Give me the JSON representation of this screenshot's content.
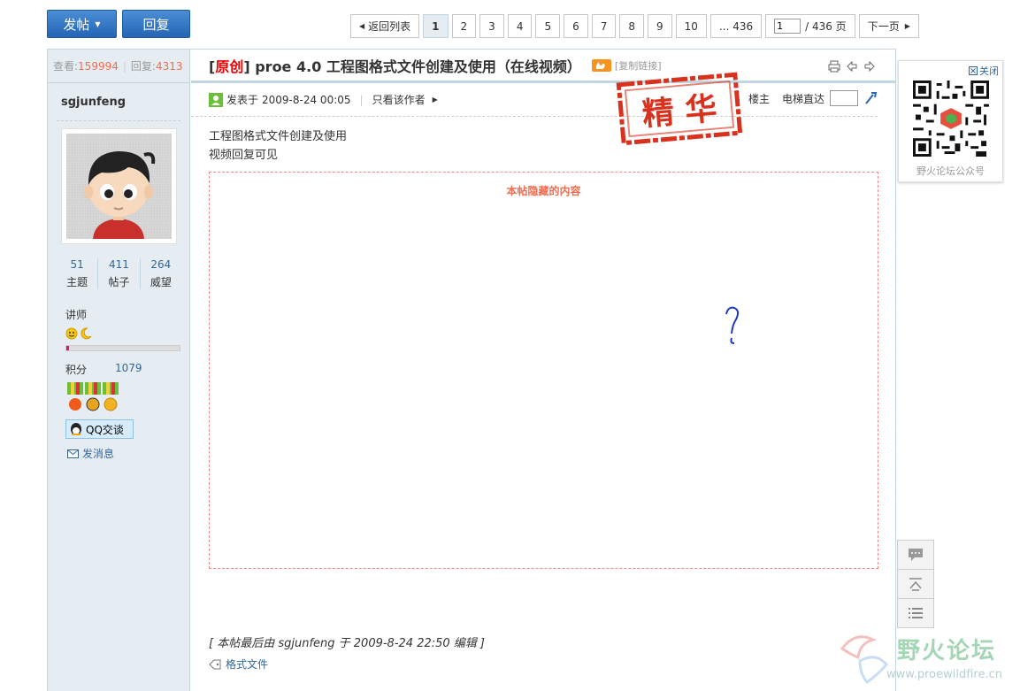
{
  "toolbar": {
    "post_label": "发帖",
    "reply_label": "回复"
  },
  "pager": {
    "back_label": "返回列表",
    "pages": [
      "1",
      "2",
      "3",
      "4",
      "5",
      "6",
      "7",
      "8",
      "9",
      "10"
    ],
    "current": "1",
    "last": "... 436",
    "input_value": "1",
    "total": "/ 436 页",
    "next_label": "下一页"
  },
  "sidebar": {
    "views_label": "查看:",
    "views": "159994",
    "replies_label": "回复:",
    "replies": "4313",
    "username": "sgjunfeng",
    "counts": [
      {
        "value": "51",
        "label": "主题"
      },
      {
        "value": "411",
        "label": "帖子"
      },
      {
        "value": "264",
        "label": "威望"
      }
    ],
    "rank": "讲师",
    "progress": 0.02,
    "score_label": "积分",
    "score": "1079",
    "qq_label": "QQ交谈",
    "msg_label": "发消息"
  },
  "post": {
    "tag": "原创",
    "title": "proe 4.0 工程图格式文件创建及使用（在线视频）",
    "copy_link": "[复制链接]",
    "posted_label": "发表于",
    "time": "2009-8-24 00:05",
    "author_only": "只看该作者",
    "floor_label": "楼主",
    "elevator_label": "电梯直达",
    "stamp": "精 华",
    "body_lines": [
      "工程图格式文件创建及使用",
      "视频回复可见"
    ],
    "hidden_title": "本帖隐藏的内容",
    "edited": "[ 本帖最后由 sgjunfeng 于 2009-8-24 22:50 编辑 ]",
    "tag_link": "格式文件"
  },
  "qr": {
    "close_label": "关闭",
    "caption": "野火论坛公众号"
  },
  "watermark": {
    "name": "野火论坛",
    "url": "www.proewildfire.cn"
  },
  "colors": {
    "accent": "#2565b4",
    "highlight": "#f26c4f",
    "sidebar_bg": "#e5edf2",
    "border": "#c2d5e3"
  }
}
